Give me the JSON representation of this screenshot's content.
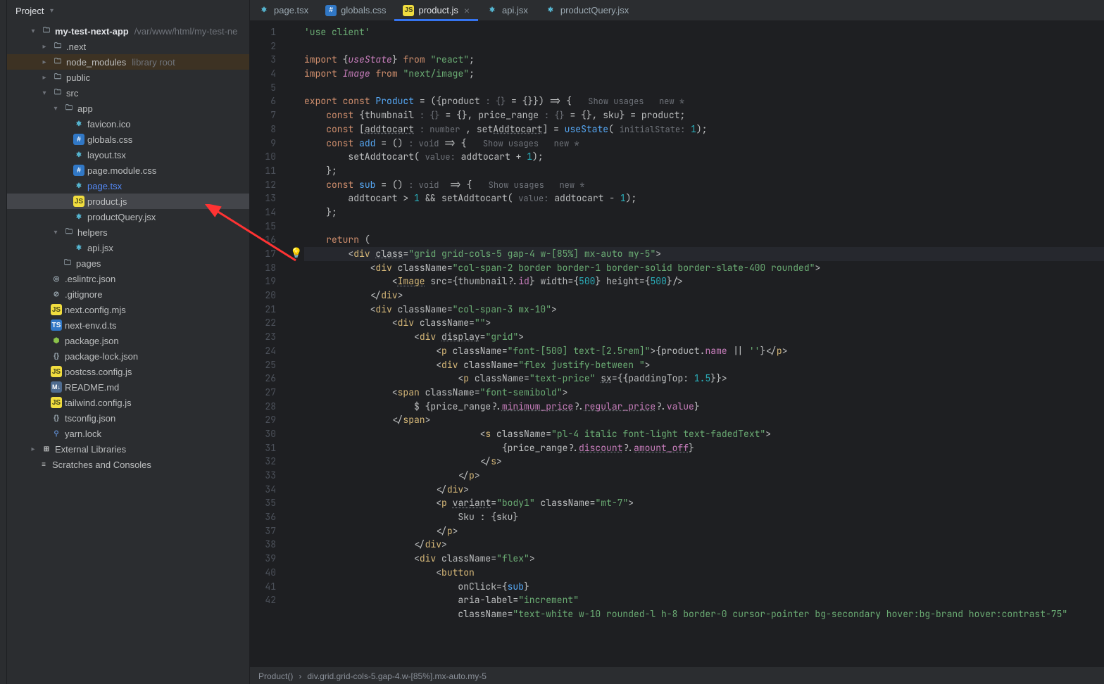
{
  "sidebar": {
    "title": "Project",
    "tree": {
      "root": {
        "label": "my-test-next-app",
        "path": "/var/www/html/my-test-ne"
      },
      "dotnext": ".next",
      "node_modules": "node_modules",
      "node_modules_hint": "library root",
      "public": "public",
      "src": "src",
      "app": "app",
      "favicon": "favicon.ico",
      "globals": "globals.css",
      "layout": "layout.tsx",
      "pagemodule": "page.module.css",
      "pagetsx": "page.tsx",
      "productjs": "product.js",
      "productquery": "productQuery.jsx",
      "helpers": "helpers",
      "apijsx": "api.jsx",
      "pages": "pages",
      "eslintrc": ".eslintrc.json",
      "gitignore": ".gitignore",
      "nextconfig": "next.config.mjs",
      "nextenv": "next-env.d.ts",
      "packagejson": "package.json",
      "packagelock": "package-lock.json",
      "postcss": "postcss.config.js",
      "readme": "README.md",
      "tailwind": "tailwind.config.js",
      "tsconfig": "tsconfig.json",
      "yarnlock": "yarn.lock",
      "extlibs": "External Libraries",
      "scratches": "Scratches and Consoles"
    }
  },
  "tabs": [
    {
      "label": "page.tsx",
      "icon": "react"
    },
    {
      "label": "globals.css",
      "icon": "css"
    },
    {
      "label": "product.js",
      "icon": "js",
      "active": true
    },
    {
      "label": "api.jsx",
      "icon": "react"
    },
    {
      "label": "productQuery.jsx",
      "icon": "react"
    }
  ],
  "breadcrumb": {
    "a": "Product()",
    "b": "div.grid.grid-cols-5.gap-4.w-[85%].mx-auto.my-5"
  },
  "code_lines": 42
}
